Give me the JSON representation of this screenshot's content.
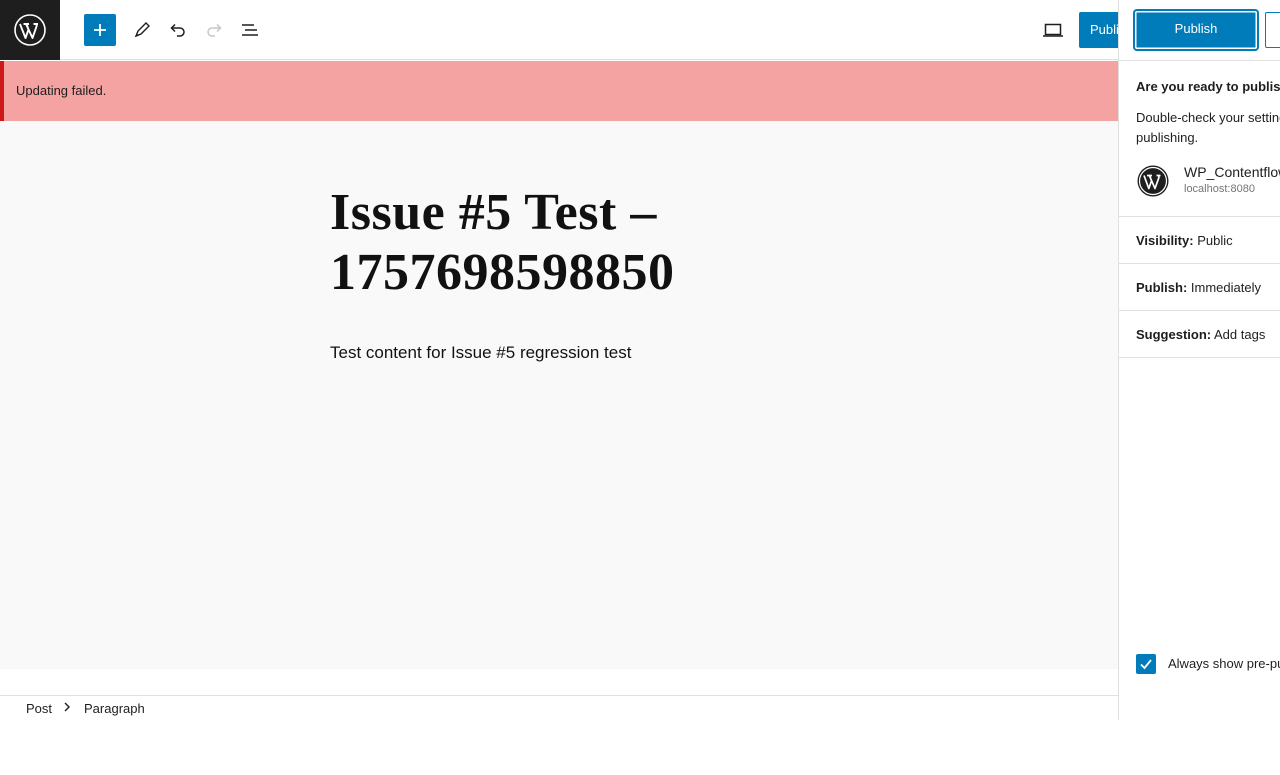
{
  "toolbar": {
    "publish_label": "Publish"
  },
  "notice": {
    "message": "Updating failed."
  },
  "editor": {
    "title": "Issue #5 Test – 1757698598850",
    "paragraph": "Test content for Issue #5 regression test"
  },
  "breadcrumb": {
    "items": [
      "Post",
      "Paragraph"
    ]
  },
  "prepublish": {
    "publish_label": "Publish",
    "heading": "Are you ready to publish?",
    "description": "Double-check your settings before publishing.",
    "site_name": "WP_Contentflow",
    "site_url": "localhost:8080",
    "visibility_label": "Visibility:",
    "visibility_value": "Public",
    "publish_label_row": "Publish:",
    "publish_value": "Immediately",
    "suggestion_label": "Suggestion:",
    "suggestion_value": "Add tags",
    "always_show_label": "Always show pre-publish checks."
  },
  "colors": {
    "accent": "#007cba",
    "notice_bg": "#f4a2a2",
    "notice_border": "#cc1818",
    "canvas_bg": "#f9f9f9"
  }
}
